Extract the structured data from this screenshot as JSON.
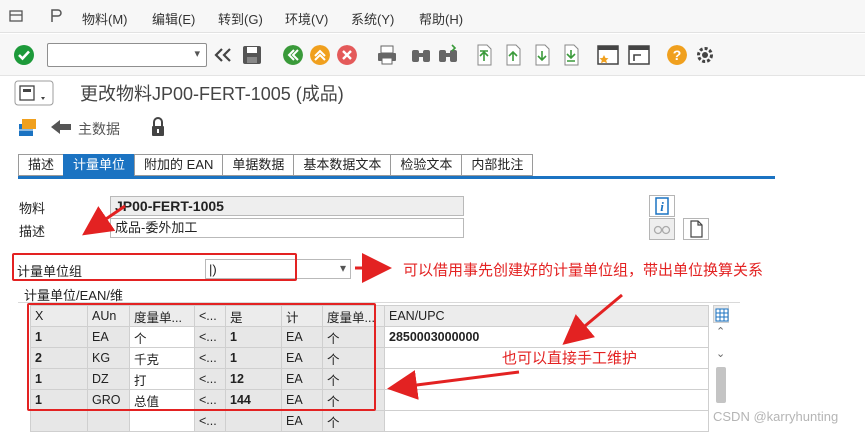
{
  "menu": {
    "items": [
      "物料(M)",
      "编辑(E)",
      "转到(G)",
      "环境(V)",
      "系统(Y)",
      "帮助(H)"
    ]
  },
  "toolbar": {
    "command_value": ""
  },
  "page": {
    "title": "更改物料JP00-FERT-1005 (成品)",
    "main_data_label": "主数据"
  },
  "tabs": [
    "描述",
    "计量单位",
    "附加的 EAN",
    "单据数据",
    "基本数据文本",
    "检验文本",
    "内部批注"
  ],
  "active_tab": 1,
  "form": {
    "material_label": "物料",
    "material_value": "JP00-FERT-1005",
    "desc_label": "描述",
    "desc_value": "成品-委外加工",
    "uom_group_label": "计量单位组",
    "uom_group_value": "|)",
    "section_title": "计量单位/EAN/维"
  },
  "table": {
    "headers": [
      "X",
      "AUn",
      "度量单...",
      "<...",
      "是",
      "计",
      "度量单...",
      "EAN/UPC"
    ],
    "rows": [
      {
        "x": "1",
        "aun": "EA",
        "desc": "个",
        "lt": "<...",
        "num": "1",
        "unit": "EA",
        "udesc": "个",
        "ean": "2850003000000"
      },
      {
        "x": "2",
        "aun": "KG",
        "desc": "千克",
        "lt": "<...",
        "num": "1",
        "unit": "EA",
        "udesc": "个",
        "ean": ""
      },
      {
        "x": "1",
        "aun": "DZ",
        "desc": "打",
        "lt": "<...",
        "num": "12",
        "unit": "EA",
        "udesc": "个",
        "ean": ""
      },
      {
        "x": "1",
        "aun": "GRO",
        "desc": "总值",
        "lt": "<...",
        "num": "144",
        "unit": "EA",
        "udesc": "个",
        "ean": ""
      },
      {
        "x": "",
        "aun": "",
        "desc": "",
        "lt": "<...",
        "num": "",
        "unit": "EA",
        "udesc": "个",
        "ean": ""
      },
      {
        "x": "",
        "aun": "",
        "desc": "",
        "lt": "<...",
        "num": "",
        "unit": "EA",
        "udesc": "个",
        "ean": ""
      }
    ]
  },
  "annotations": {
    "a1": "可以借用事先创建好的计量单位组，带出单位换算关系",
    "a2": "也可以直接手工维护"
  },
  "watermark": "CSDN @karryhunting",
  "colors": {
    "accent": "#1b73c2",
    "annotation_red": "#e32222",
    "ok_green": "#1d9a3a",
    "nav_green": "#3a9a3a",
    "warn_orange": "#f0a01e",
    "help_orange": "#f0a01e"
  }
}
